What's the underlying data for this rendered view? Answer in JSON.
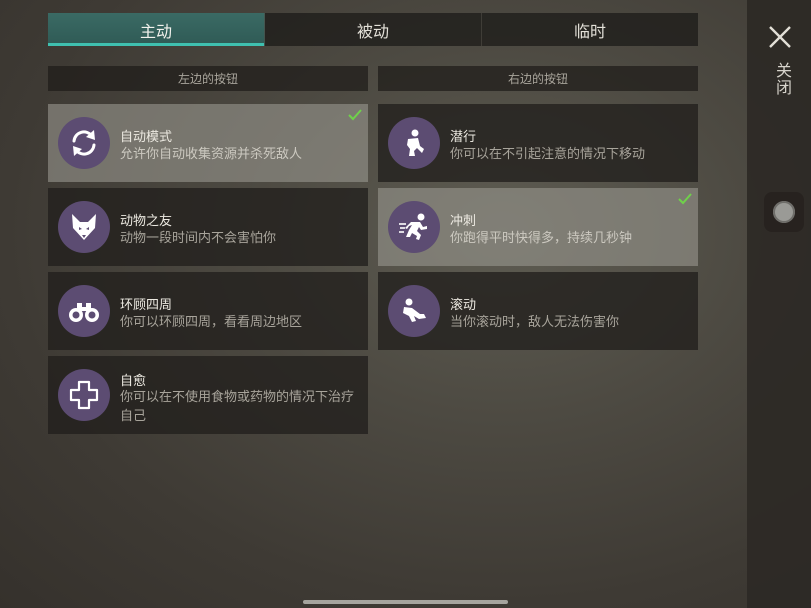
{
  "tabs": [
    {
      "label": "主动",
      "active": true
    },
    {
      "label": "被动",
      "active": false
    },
    {
      "label": "临时",
      "active": false
    }
  ],
  "close_label": "关闭",
  "left_column": {
    "header": "左边的按钮",
    "items": [
      {
        "title": "自动模式",
        "desc": "允许你自动收集资源并杀死敌人",
        "icon": "refresh-icon",
        "selected": true
      },
      {
        "title": "动物之友",
        "desc": "动物一段时间内不会害怕你",
        "icon": "fox-icon",
        "selected": false
      },
      {
        "title": "环顾四周",
        "desc": "你可以环顾四周，看看周边地区",
        "icon": "binoculars-icon",
        "selected": false
      },
      {
        "title": "自愈",
        "desc": "你可以在不使用食物或药物的情况下治疗自己",
        "icon": "medical-cross-icon",
        "selected": false
      }
    ]
  },
  "right_column": {
    "header": "右边的按钮",
    "items": [
      {
        "title": "潜行",
        "desc": "你可以在不引起注意的情况下移动",
        "icon": "sneak-icon",
        "selected": false
      },
      {
        "title": "冲刺",
        "desc": "你跑得平时快得多，持续几秒钟",
        "icon": "sprint-icon",
        "selected": true
      },
      {
        "title": "滚动",
        "desc": "当你滚动时，敌人无法伤害你",
        "icon": "roll-icon",
        "selected": false
      }
    ]
  },
  "colors": {
    "accent": "#3fc0b0",
    "icon_bg": "#5c4c72",
    "check": "#6fd14a"
  }
}
